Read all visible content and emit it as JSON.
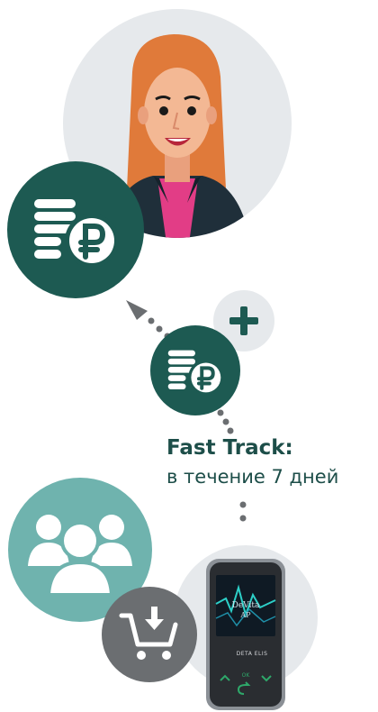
{
  "colors": {
    "dark_teal": "#1d5a52",
    "light_teal": "#6fb3ae",
    "light_gray": "#e6e9ec",
    "mid_gray": "#6b6e71",
    "text": "#1d4e49"
  },
  "icons": [
    "woman-avatar",
    "coins-ruble-icon",
    "plus-icon",
    "group-icon",
    "cart-download-icon",
    "device-image"
  ],
  "fast_track": {
    "title": "Fast Track:",
    "subtitle": "в течение 7 дней"
  },
  "device": {
    "screen_brand": "DeVita",
    "screen_model": "AP",
    "label": "DETA ELIS",
    "ok": "OK"
  }
}
